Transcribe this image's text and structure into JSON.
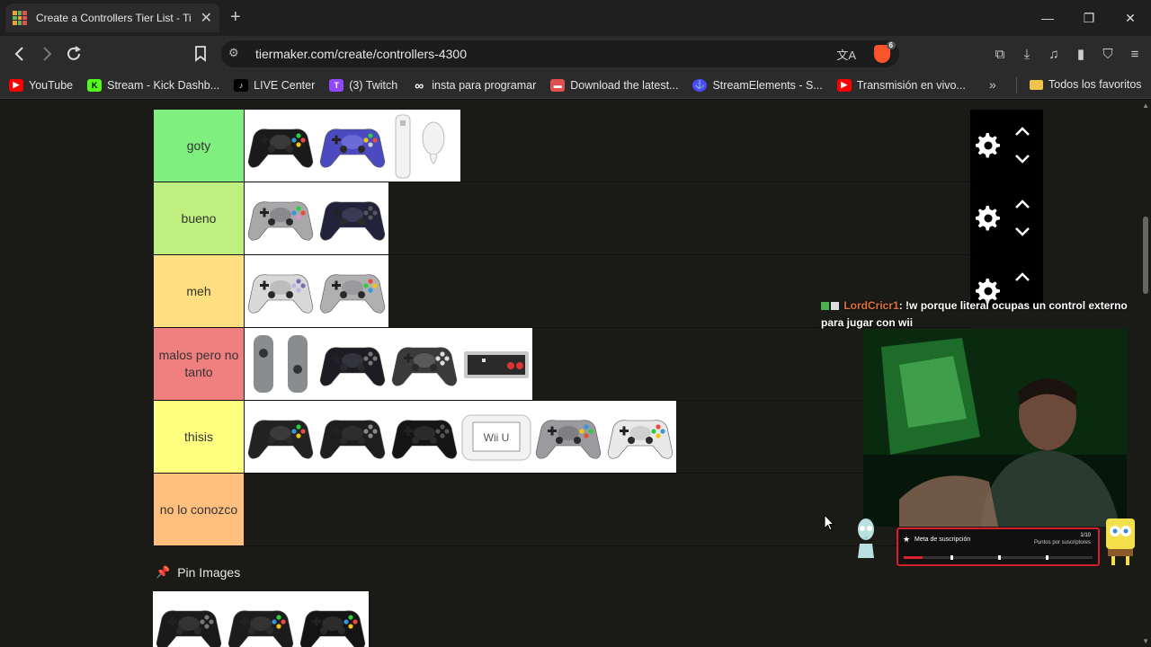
{
  "browser": {
    "tab_title": "Create a Controllers Tier List - Ti",
    "url": "tiermaker.com/create/controllers-4300",
    "brave_badge": "6",
    "bookmarks": [
      {
        "label": "YouTube",
        "color": "#ff0000"
      },
      {
        "label": "Stream - Kick Dashb...",
        "color": "#53fc18"
      },
      {
        "label": "LIVE Center",
        "color": "#000000"
      },
      {
        "label": "(3) Twitch",
        "color": "#9146ff"
      },
      {
        "label": "insta para programar",
        "color": "#2b2b2b"
      },
      {
        "label": "Download the latest...",
        "color": "#e05050"
      },
      {
        "label": "StreamElements - S...",
        "color": "#4a4aff"
      },
      {
        "label": "Transmisión en vivo...",
        "color": "#ff0000"
      }
    ],
    "bookmarks_folder": "Todos los favoritos"
  },
  "tiers": [
    {
      "label": "goty",
      "color": "#7ff07f",
      "items": [
        "xbox-360-controller",
        "gamecube-controller",
        "wii-remote-nunchuk"
      ]
    },
    {
      "label": "bueno",
      "color": "#bff07f",
      "items": [
        "ps1-controller",
        "ps2-controller"
      ]
    },
    {
      "label": "meh",
      "color": "#ffdf7f",
      "items": [
        "snes-controller-us",
        "snes-controller"
      ]
    },
    {
      "label": "malos pero no tanto",
      "color": "#f07f7f",
      "items": [
        "joy-con",
        "ps4-controller",
        "switch-pro-controller",
        "nes-controller"
      ]
    },
    {
      "label": "thisis",
      "color": "#ffff7f",
      "items": [
        "xbox-duke-controller",
        "saturn-3d-controller",
        "genesis-controller",
        "wii-u-gamepad",
        "n64-controller",
        "dreamcast-controller"
      ]
    },
    {
      "label": "no lo conozco",
      "color": "#ffbf7f",
      "items": []
    }
  ],
  "pin_images": {
    "title": "Pin Images",
    "items": [
      "ps3-controller",
      "xbox-one-controller-wired",
      "xbox-series-controller"
    ]
  },
  "overlay": {
    "chat_user": "LordCricr1",
    "chat_message": ": !w porque literal ocupas un control externo para jugar con wii",
    "goal_title": "Meta de suscripción",
    "goal_count": "1/10",
    "goal_subtitle": "Puntos por suscriptores",
    "goal_progress": 0.1
  }
}
